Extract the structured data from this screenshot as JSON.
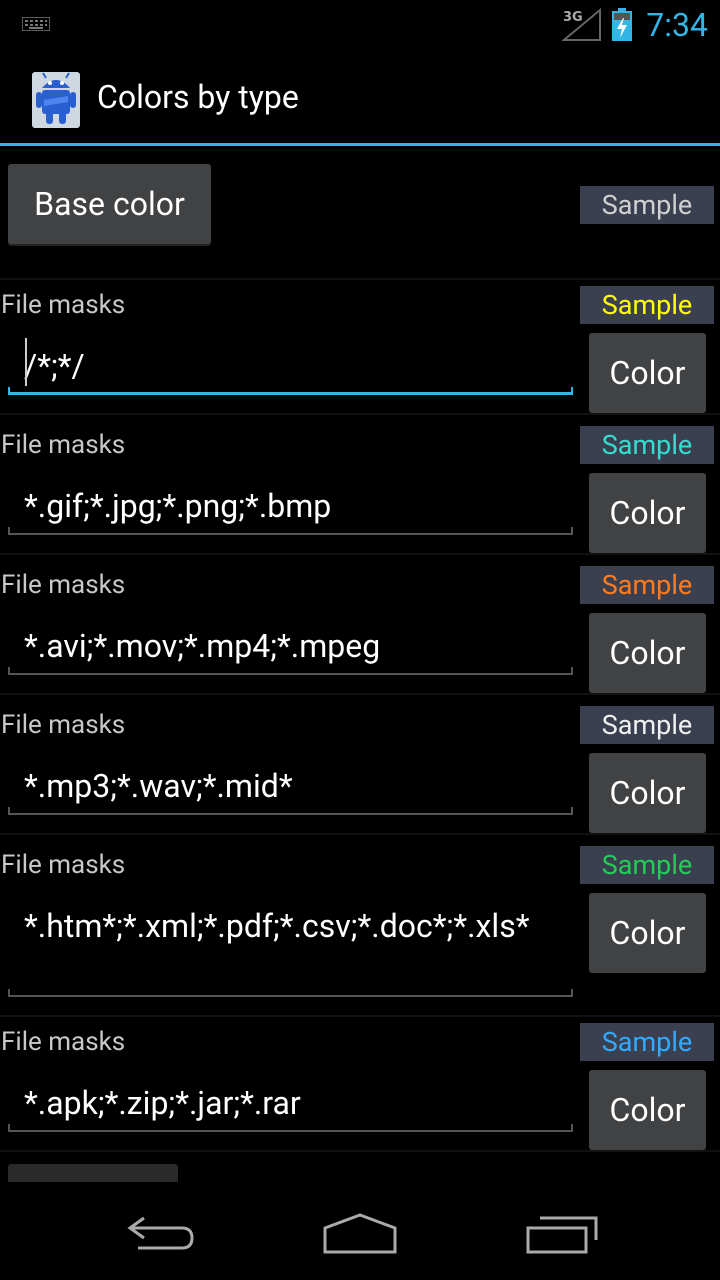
{
  "status_bar": {
    "time": "7:34",
    "network": "3G"
  },
  "action_bar": {
    "title": "Colors by type"
  },
  "base": {
    "button_label": "Base color",
    "sample_label": "Sample",
    "sample_color": "#d0d0d0"
  },
  "rows": [
    {
      "label": "File masks",
      "sample": "Sample",
      "sample_color": "#ffff00",
      "value": "/*;*/",
      "button": "Color"
    },
    {
      "label": "File masks",
      "sample": "Sample",
      "sample_color": "#33ddd0",
      "value": "*.gif;*.jpg;*.png;*.bmp",
      "button": "Color"
    },
    {
      "label": "File masks",
      "sample": "Sample",
      "sample_color": "#ff7a1a",
      "value": "*.avi;*.mov;*.mp4;*.mpeg",
      "button": "Color"
    },
    {
      "label": "File masks",
      "sample": "Sample",
      "sample_color": "#f0f0f0",
      "value": "*.mp3;*.wav;*.mid*",
      "button": "Color"
    },
    {
      "label": "File masks",
      "sample": "Sample",
      "sample_color": "#22cc55",
      "value": "*.htm*;*.xml;*.pdf;*.csv;*.doc*;*.xls*",
      "button": "Color"
    },
    {
      "label": "File masks",
      "sample": "Sample",
      "sample_color": "#33aaff",
      "value": "*.apk;*.zip;*.jar;*.rar",
      "button": "Color"
    }
  ],
  "colors": {
    "accent": "#33b5e5",
    "button_bg": "#404244",
    "sample_bg": "#3b4050"
  }
}
